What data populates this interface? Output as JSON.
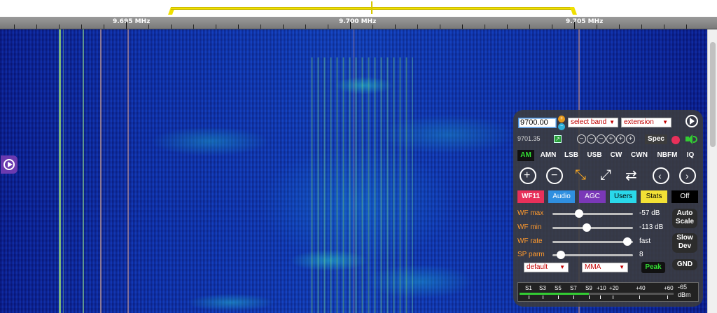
{
  "scale": {
    "labels": [
      "9.695 MHz",
      "9.700 MHz",
      "9.705 MHz"
    ]
  },
  "waterfall": {
    "colors": {
      "background": "#1236b0",
      "signal": "#9ee070",
      "edge": "#0c1c8c"
    }
  },
  "panel": {
    "freq_input_value": "9700.00",
    "band_select": "select band",
    "extension_select": "extension",
    "readout_freq": "9701.35",
    "spec_label": "Spec",
    "zoom_icons": [
      "minus-icon",
      "minus-icon",
      "minus-icon",
      "plus-icon",
      "plus-icon",
      "plus-icon"
    ],
    "modes": [
      "AM",
      "AMN",
      "LSB",
      "USB",
      "CW",
      "CWN",
      "NBFM",
      "IQ"
    ],
    "active_mode": "AM",
    "tabs": [
      {
        "label": "WF11",
        "bg": "#e8305a",
        "fg": "#ffffff"
      },
      {
        "label": "Audio",
        "bg": "#2f8fe0",
        "fg": "#ffffff"
      },
      {
        "label": "AGC",
        "bg": "#7a38b8",
        "fg": "#ffffff"
      },
      {
        "label": "Users",
        "bg": "#2ad8ea",
        "fg": "#000000"
      },
      {
        "label": "Stats",
        "bg": "#f3e135",
        "fg": "#000000"
      },
      {
        "label": "Off",
        "bg": "#000000",
        "fg": "#ffffff"
      }
    ],
    "sliders": [
      {
        "label": "WF max",
        "value": "-57 dB",
        "level": 0.33
      },
      {
        "label": "WF min",
        "value": "-113 dB",
        "level": 0.43
      },
      {
        "label": "WF rate",
        "value": "fast",
        "level": 0.93
      },
      {
        "label": "SP parm",
        "value": "8",
        "level": 0.1
      }
    ],
    "right_buttons": {
      "auto": [
        "Auto",
        "Scale"
      ],
      "slow": [
        "Slow",
        "Dev"
      ],
      "gnd": "GND"
    },
    "colormap_select": "default",
    "mma_select": "MMA",
    "peak_label": "Peak",
    "smeter": {
      "labels": [
        "S1",
        "S3",
        "S5",
        "S7",
        "S9",
        "+10",
        "+20",
        "+40",
        "+60"
      ],
      "value": "-65",
      "unit": "dBm",
      "level": 0.45
    }
  }
}
